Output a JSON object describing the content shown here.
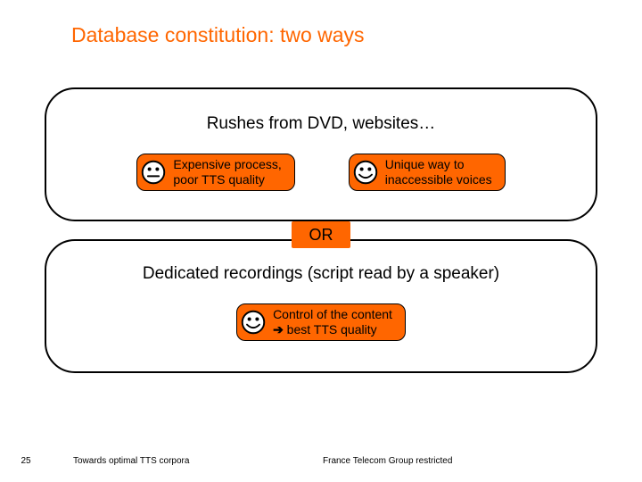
{
  "title": "Database constitution: two ways",
  "panel1": {
    "header": "Rushes from DVD, websites…",
    "pill_neg": {
      "line1": "Expensive process,",
      "line2": "poor TTS quality"
    },
    "pill_pos": {
      "line1": "Unique way to",
      "line2": "inaccessible voices"
    }
  },
  "or_label": "OR",
  "panel2": {
    "header": "Dedicated recordings (script read by a speaker)",
    "pill": {
      "line1": "Control of the content",
      "line2_arrow": "➔",
      "line2_rest": " best TTS quality"
    }
  },
  "footer": {
    "page": "25",
    "title": "Towards optimal TTS corpora",
    "classification": "France Telecom Group restricted"
  }
}
